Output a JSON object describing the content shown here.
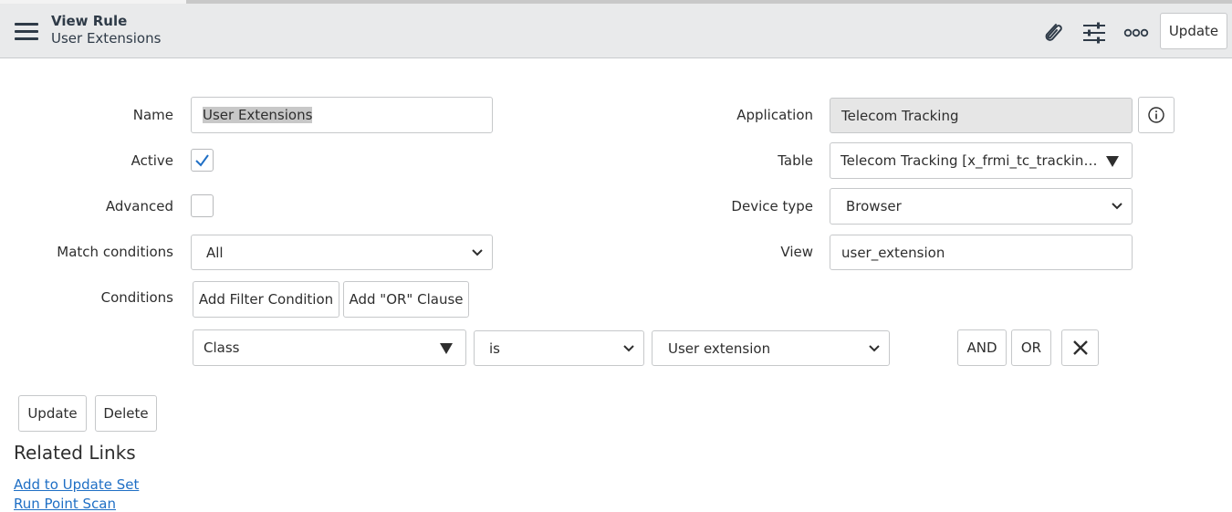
{
  "header": {
    "title": "View Rule",
    "subtitle": "User Extensions",
    "icons": [
      "menu-icon",
      "paperclip-icon",
      "sliders-icon",
      "more-icon"
    ],
    "update_label": "Update"
  },
  "form": {
    "name_label": "Name",
    "name_value": "User Extensions",
    "active_label": "Active",
    "active_checked": true,
    "advanced_label": "Advanced",
    "advanced_checked": false,
    "match_label": "Match conditions",
    "match_value": "All",
    "conditions_label": "Conditions",
    "add_filter_label": "Add Filter Condition",
    "add_or_label": "Add \"OR\" Clause",
    "application_label": "Application",
    "application_value": "Telecom Tracking",
    "table_label": "Table",
    "table_value": "Telecom Tracking [x_frmi_tc_tracking_t…",
    "device_label": "Device type",
    "device_value": "Browser",
    "view_label": "View",
    "view_value": "user_extension"
  },
  "condition_row": {
    "field": "Class",
    "operator": "is",
    "value": "User extension",
    "and_label": "AND",
    "or_label": "OR"
  },
  "actions": {
    "update_label": "Update",
    "delete_label": "Delete"
  },
  "related": {
    "title": "Related Links",
    "links": [
      "Add to Update Set",
      "Run Point Scan"
    ]
  },
  "colors": {
    "header_bg": "#e9eaeb",
    "link": "#1f6fc5",
    "check": "#1f6fc5"
  }
}
